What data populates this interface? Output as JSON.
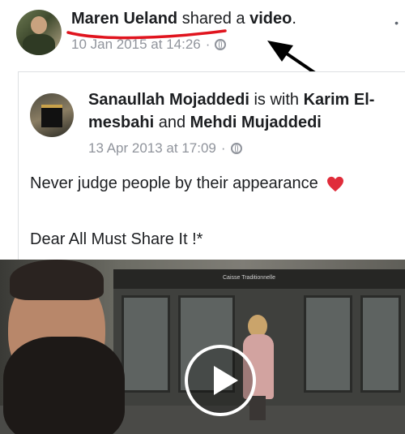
{
  "post": {
    "author": "Maren Ueland",
    "action_prefix": " shared a ",
    "action_object": "video",
    "action_suffix": ".",
    "timestamp": "10 Jan 2015 at 14:26",
    "separator": "·",
    "privacy_icon": "globe-icon",
    "options_icon": "more-icon"
  },
  "shared": {
    "author": "Sanaullah Mojaddedi",
    "with_text": " is with ",
    "tagged_1": "Karim El-mesbahi",
    "and_text": " and ",
    "tagged_2": "Mehdi Mujaddedi",
    "timestamp": "13 Apr 2013 at 17:09",
    "separator": "·",
    "privacy_icon": "globe-icon",
    "message_line1": "Never judge people by their appearance",
    "message_line2": "Dear All Must Share It !*",
    "emoji": "red-heart"
  },
  "video": {
    "shop_sign": "Caisse Traditionnelle",
    "play_icon": "play-icon"
  },
  "colors": {
    "meta_gray": "#90949c",
    "annotation_red": "#e0141e",
    "heart_red": "#e02c3a",
    "arrow": "#000000"
  }
}
